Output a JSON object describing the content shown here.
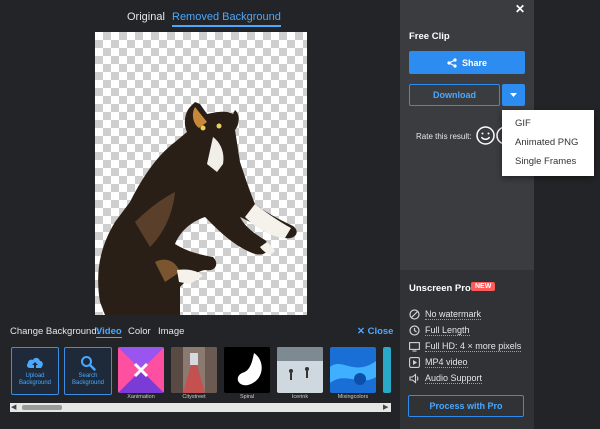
{
  "view_tabs": {
    "original": "Original",
    "removed": "Removed Background"
  },
  "change_background": {
    "label": "Change Background:",
    "tabs": [
      "Video",
      "Color",
      "Image"
    ],
    "active_tab": "Video",
    "close_label": "✕ Close",
    "upload": "Upload Background",
    "search": "Search Background",
    "thumbnails": [
      "Xanimation",
      "Citystreet",
      "Spiral",
      "Icerink",
      "Mixingcolors",
      ""
    ]
  },
  "panel": {
    "close": "✕",
    "free_clip": "Free Clip",
    "share": "Share",
    "download": "Download",
    "rate": "Rate this result:",
    "dropdown": [
      "GIF",
      "Animated PNG",
      "Single Frames"
    ],
    "pro_title": "Unscreen Pro",
    "new_badge": "NEW",
    "features": [
      {
        "icon": "no-watermark-icon",
        "text": "No watermark"
      },
      {
        "icon": "clock-icon",
        "text": "Full Length"
      },
      {
        "icon": "hd-icon",
        "text": "Full HD: 4 × more pixels"
      },
      {
        "icon": "play-icon",
        "text": "MP4 video"
      },
      {
        "icon": "speaker-icon",
        "text": "Audio Support"
      }
    ],
    "process": "Process with Pro"
  },
  "colors": {
    "accent": "#2d8cf0",
    "badge": "#ff5a5a",
    "panel": "#3a3c40",
    "bg": "#232427"
  }
}
